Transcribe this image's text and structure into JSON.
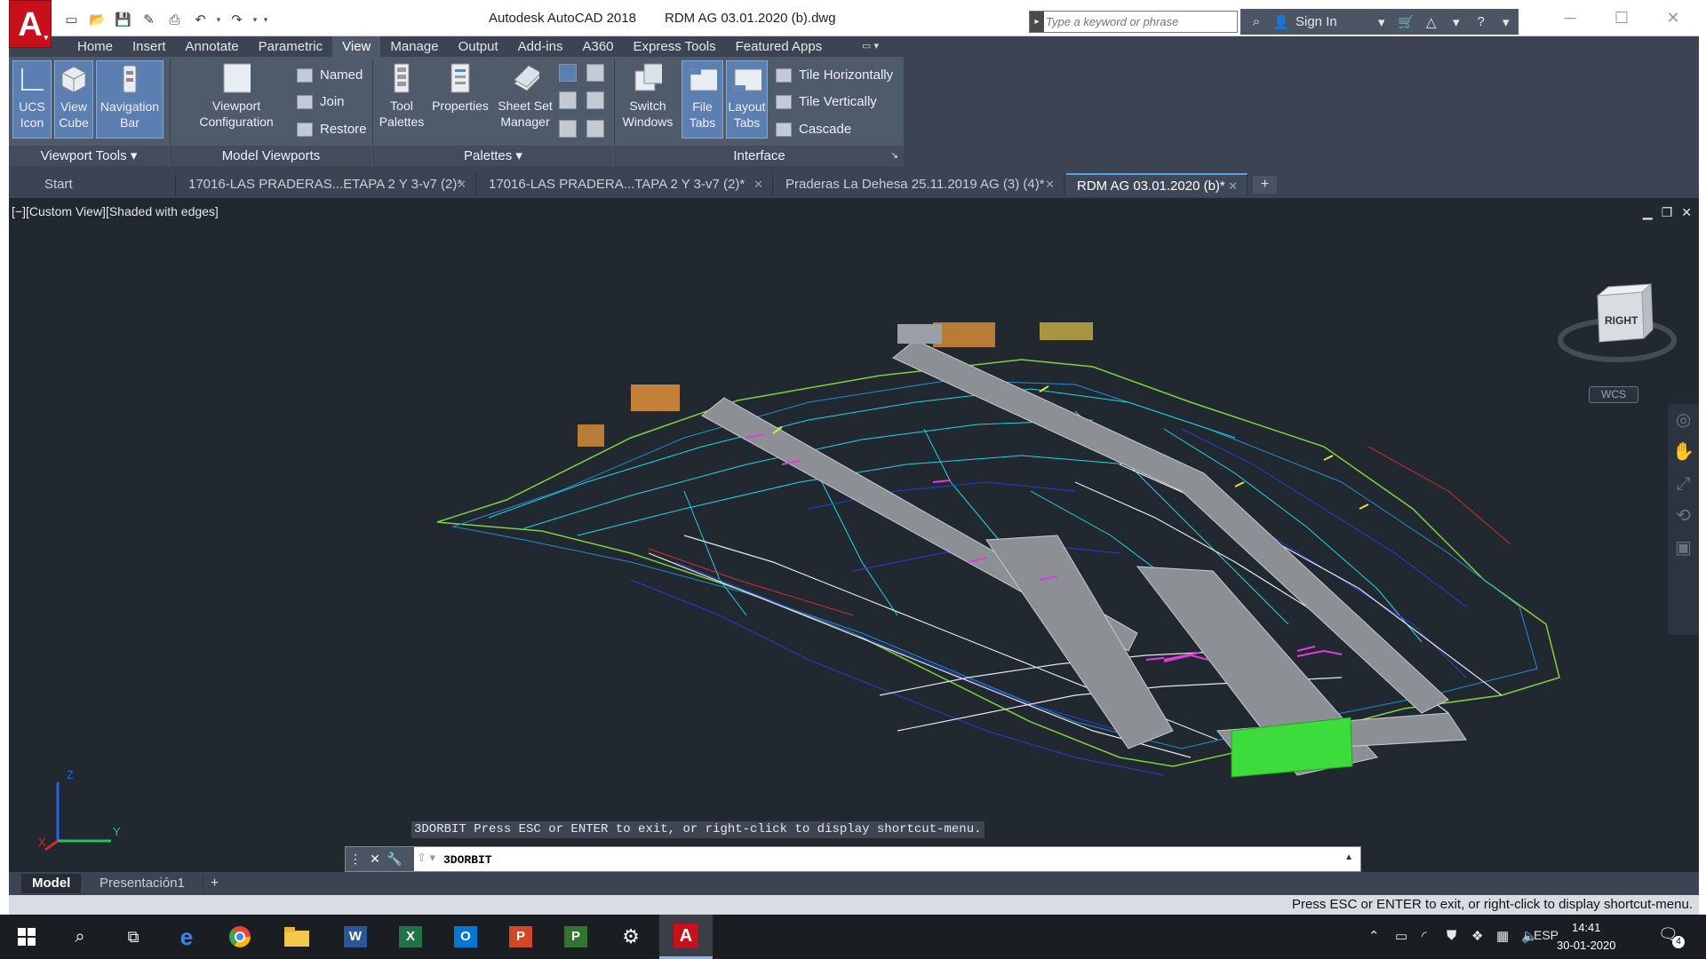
{
  "window": {
    "app_title": "Autodesk AutoCAD 2018",
    "doc_title": "RDM AG 03.01.2020 (b).dwg",
    "search_placeholder": "Type a keyword or phrase",
    "sign_in": "Sign In"
  },
  "ribbon_tabs": [
    "Home",
    "Insert",
    "Annotate",
    "Parametric",
    "View",
    "Manage",
    "Output",
    "Add-ins",
    "A360",
    "Express Tools",
    "Featured Apps"
  ],
  "active_tab": "View",
  "ribbon": {
    "ucs_icon": "UCS\nIcon",
    "view_cube": "View\nCube",
    "navigation_bar": "Navigation\nBar",
    "viewport_configuration": "Viewport\nConfiguration",
    "named": "Named",
    "join": "Join",
    "restore": "Restore",
    "tool_palettes": "Tool\nPalettes",
    "properties": "Properties",
    "sheet_set_manager": "Sheet Set\nManager",
    "switch_windows": "Switch\nWindows",
    "file_tabs": "File\nTabs",
    "layout_tabs": "Layout\nTabs",
    "tile_horizontally": "Tile Horizontally",
    "tile_vertically": "Tile Vertically",
    "cascade": "Cascade",
    "panel_viewport_tools": "Viewport Tools",
    "panel_model_viewports": "Model Viewports",
    "panel_palettes": "Palettes",
    "panel_interface": "Interface"
  },
  "doc_tabs": [
    {
      "label": "Start"
    },
    {
      "label": "17016-LAS PRADERAS...ETAPA 2 Y 3-v7 (2)*"
    },
    {
      "label": "17016-LAS PRADERA...TAPA 2 Y 3-v7 (2)*"
    },
    {
      "label": "Praderas La Dehesa 25.11.2019 AG (3) (4)*"
    },
    {
      "label": "RDM AG 03.01.2020 (b)*"
    }
  ],
  "viewport": {
    "label": "[−][Custom View][Shaded with edges]",
    "viewcube_face": "RIGHT",
    "wcs": "WCS",
    "ucs_x": "X",
    "ucs_y": "Y",
    "ucs_z": "Z"
  },
  "command": {
    "prompt": "3DORBIT Press ESC or ENTER to exit, or right-click to display shortcut-menu.",
    "input": "3DORBIT"
  },
  "layout_tabs": [
    "Model",
    "Presentación1"
  ],
  "status_message": "Press ESC or ENTER to exit, or right-click to display shortcut-menu.",
  "taskbar": {
    "lang": "ESP",
    "time": "14:41",
    "date": "30-01-2020",
    "notifications": "4"
  },
  "colors": {
    "accent": "#c8101a",
    "ribbon_bg": "#4f5a6b",
    "viewport_bg": "#212830",
    "selected_button": "#5c7fb1"
  }
}
